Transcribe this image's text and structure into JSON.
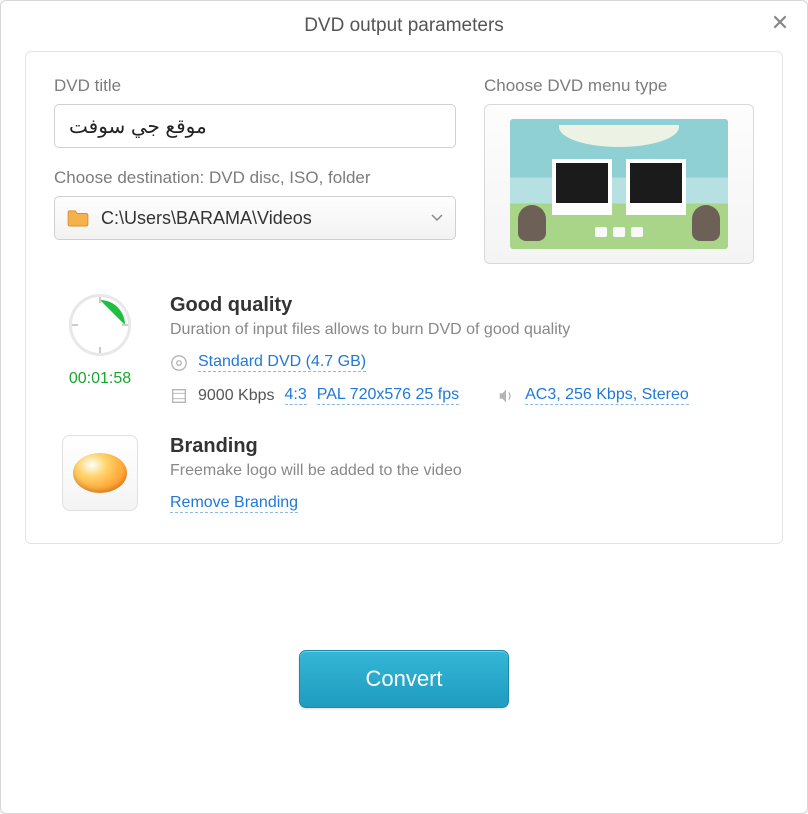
{
  "window": {
    "title": "DVD output parameters"
  },
  "labels": {
    "dvd_title": "DVD title",
    "menu_type": "Choose DVD menu type",
    "destination": "Choose destination: DVD disc, ISO, folder"
  },
  "inputs": {
    "title_value": "موقع جي سوفت",
    "destination_path": "C:\\Users\\BARAMA\\Videos"
  },
  "quality": {
    "heading": "Good quality",
    "description": "Duration of input files allows to burn DVD of good quality",
    "duration": "00:01:58",
    "disc_type": "Standard DVD (4.7 GB)",
    "bitrate": "9000 Kbps",
    "aspect": "4:3",
    "video_format": "PAL 720x576 25 fps",
    "audio_format": "AC3, 256 Kbps, Stereo"
  },
  "branding": {
    "heading": "Branding",
    "description": "Freemake logo will be added to the video",
    "remove_link": "Remove Branding"
  },
  "actions": {
    "convert": "Convert"
  }
}
